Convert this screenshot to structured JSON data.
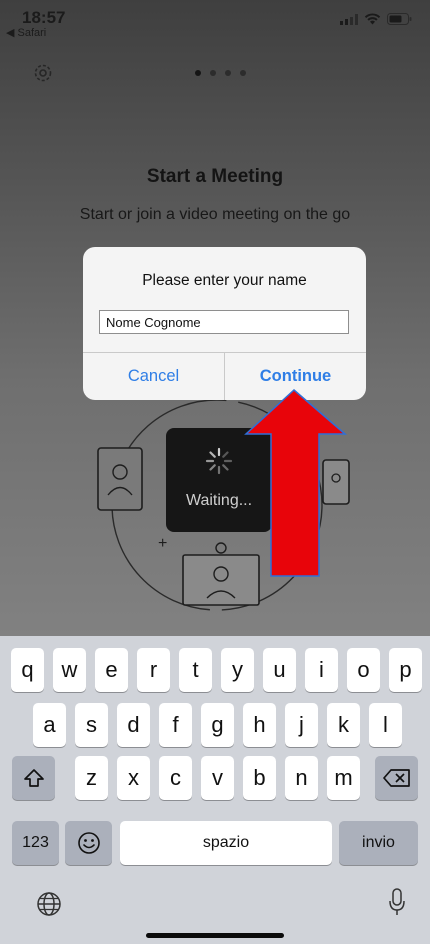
{
  "status_bar": {
    "time": "18:57",
    "back_app": "◀ Safari"
  },
  "onboarding": {
    "headline": "Start a Meeting",
    "subline": "Start or join a video meeting on the go",
    "waiting_label": "Waiting..."
  },
  "dialog": {
    "title": "Please enter your name",
    "input_value": "Nome Cognome",
    "cancel_label": "Cancel",
    "continue_label": "Continue"
  },
  "keyboard": {
    "row1": [
      "q",
      "w",
      "e",
      "r",
      "t",
      "y",
      "u",
      "i",
      "o",
      "p"
    ],
    "row2": [
      "a",
      "s",
      "d",
      "f",
      "g",
      "h",
      "j",
      "k",
      "l"
    ],
    "row3": [
      "z",
      "x",
      "c",
      "v",
      "b",
      "n",
      "m"
    ],
    "numbers_label": "123",
    "space_label": "spazio",
    "return_label": "invio",
    "icons": [
      "shift-icon",
      "backspace-icon",
      "emoji-icon",
      "globe-icon",
      "microphone-icon"
    ]
  },
  "annotation": {
    "arrow_color": "#e8040a",
    "arrow_outline": "#2f6fd8"
  },
  "colors": {
    "accent": "#2f7ee6"
  }
}
